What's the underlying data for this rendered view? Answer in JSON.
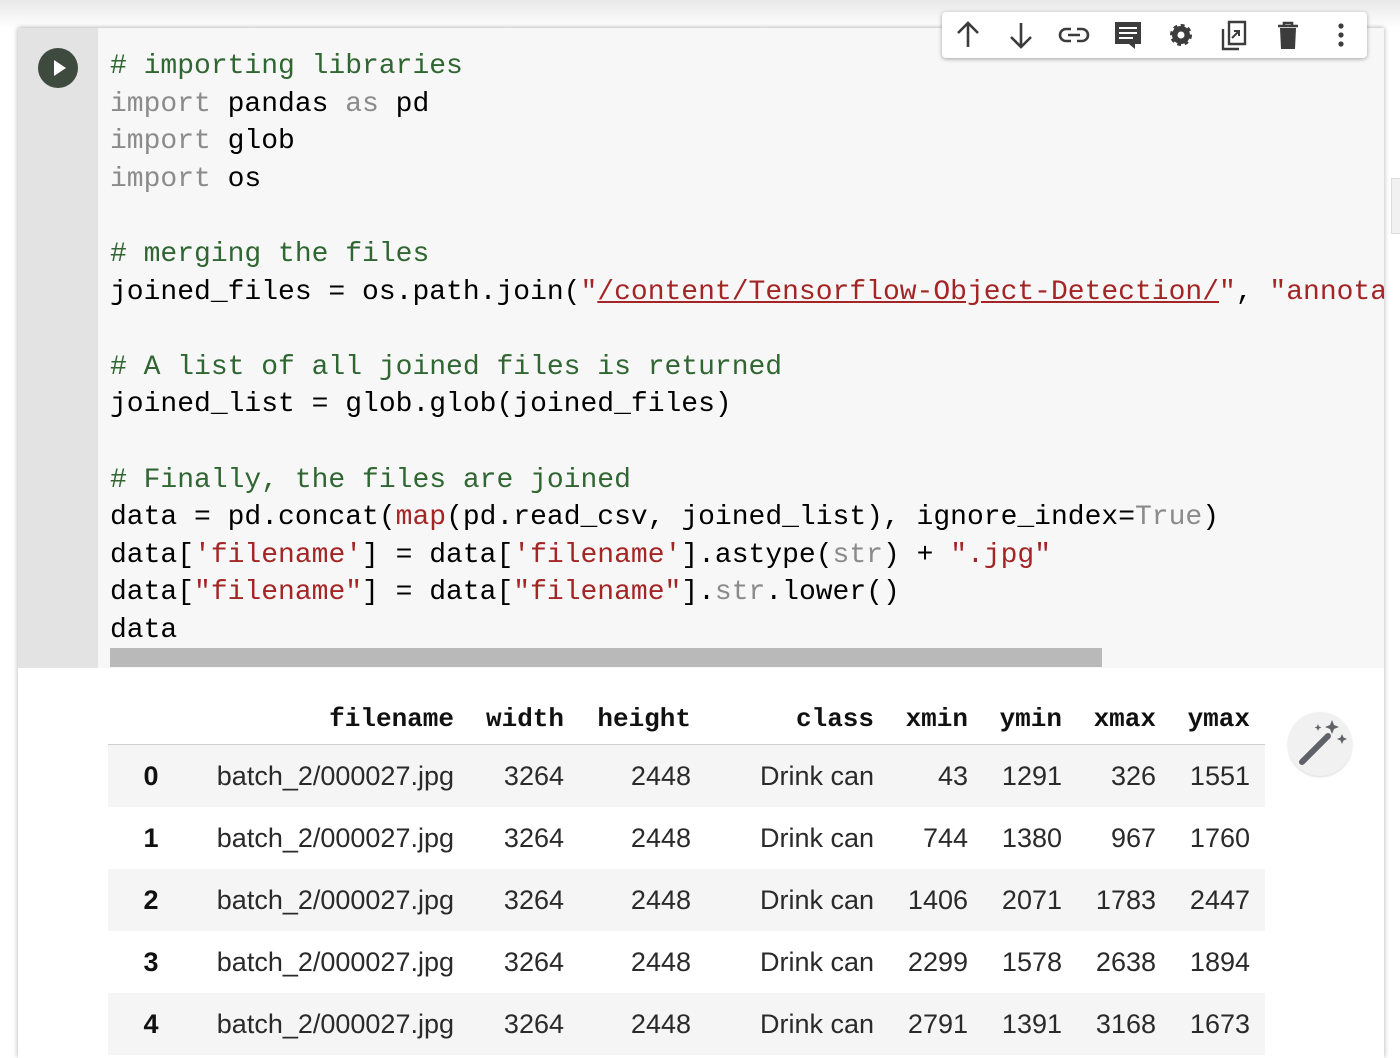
{
  "toolbar": {
    "buttons": [
      {
        "name": "move-up",
        "icon": "arrow-up-icon"
      },
      {
        "name": "move-down",
        "icon": "arrow-down-icon"
      },
      {
        "name": "link",
        "icon": "link-icon"
      },
      {
        "name": "comment",
        "icon": "comment-icon"
      },
      {
        "name": "settings",
        "icon": "gear-icon"
      },
      {
        "name": "mirror-in-tab",
        "icon": "mirror-cell-icon"
      },
      {
        "name": "delete",
        "icon": "trash-icon"
      },
      {
        "name": "more",
        "icon": "more-vert-icon"
      }
    ]
  },
  "code": {
    "line1": "# importing libraries",
    "line2": {
      "kw": "import",
      "rest1": " pandas ",
      "kw2": "as",
      "rest2": " pd"
    },
    "line3": {
      "kw": "import",
      "rest": " glob"
    },
    "line4": {
      "kw": "import",
      "rest": " os"
    },
    "line6": "# merging the files",
    "line7": {
      "pre": "joined_files = os.path.join(",
      "q1": "\"",
      "path": "/content/Tensorflow-Object-Detection/",
      "q2": "\"",
      "sep": ", ",
      "str2": "\"annota"
    },
    "line9": "# A list of all joined files is returned",
    "line10": "joined_list = glob.glob(joined_files)",
    "line12": "# Finally, the files are joined",
    "line13": {
      "pre": "data = pd.concat(",
      "map": "map",
      "mid": "(pd.read_csv, joined_list), ignore_index=",
      "true": "True",
      "end": ")"
    },
    "line14": {
      "a": "data[",
      "s1": "'filename'",
      "b": "] = data[",
      "s2": "'filename'",
      "c": "].astype(",
      "str": "str",
      "d": ") + ",
      "s3": "\".jpg\""
    },
    "line15": {
      "a": "data[",
      "s1": "\"filename\"",
      "b": "] = data[",
      "s2": "\"filename\"",
      "c": "].",
      "str": "str",
      "d": ".lower()"
    },
    "line16": "data"
  },
  "output": {
    "columns": [
      "",
      "filename",
      "width",
      "height",
      "class",
      "xmin",
      "ymin",
      "xmax",
      "ymax"
    ],
    "rows": [
      [
        "0",
        "batch_2/000027.jpg",
        "3264",
        "2448",
        "Drink can",
        "43",
        "1291",
        "326",
        "1551"
      ],
      [
        "1",
        "batch_2/000027.jpg",
        "3264",
        "2448",
        "Drink can",
        "744",
        "1380",
        "967",
        "1760"
      ],
      [
        "2",
        "batch_2/000027.jpg",
        "3264",
        "2448",
        "Drink can",
        "1406",
        "2071",
        "1783",
        "2447"
      ],
      [
        "3",
        "batch_2/000027.jpg",
        "3264",
        "2448",
        "Drink can",
        "2299",
        "1578",
        "2638",
        "1894"
      ],
      [
        "4",
        "batch_2/000027.jpg",
        "3264",
        "2448",
        "Drink can",
        "2791",
        "1391",
        "3168",
        "1673"
      ]
    ]
  },
  "colors": {
    "comment": "#2f6631",
    "keyword": "#8b8b8b",
    "string": "#a32525",
    "run_button": "#3d4a3d"
  }
}
